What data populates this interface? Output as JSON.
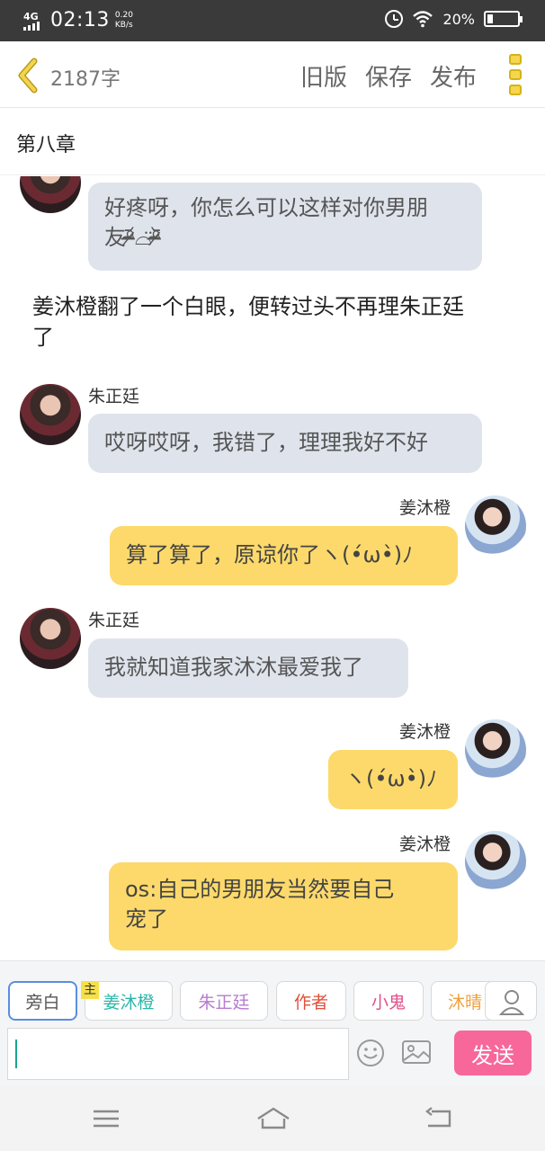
{
  "status_bar": {
    "network": "4G",
    "time": "02:13",
    "speed_value": "0.20",
    "speed_unit": "KB/s",
    "battery": "20%",
    "battery_level": 0.2
  },
  "top_bar": {
    "word_count": "2187字",
    "actions": [
      "旧版",
      "保存",
      "发布"
    ]
  },
  "chapter_title": "第八章",
  "chat": {
    "bubble1": "好疼呀，你怎么可以这样对你男朋友ᕙ( ︡'︡益'︠)ง",
    "bubble1_line1": "好疼呀，你怎么可以这样对你男朋",
    "bubble1_line2": "友ᵒ̴̶̷᷄⌓̈ᵒ̴̶̷᷅",
    "narration_line1": "姜沐橙翻了一个白眼，便转过头不再理朱正廷",
    "narration_line2": "了",
    "name_zhu": "朱正廷",
    "name_jiang": "姜沐橙",
    "bubble2": "哎呀哎呀，我错了，理理我好不好",
    "bubble3": "算了算了，原谅你了ヽ(•́ω•̀)ﾉ",
    "bubble4": "我就知道我家沐沐最爱我了",
    "bubble5": "ヽ(•́ω•̀)ﾉ",
    "bubble6_line1": "os:自己的男朋友当然要自己",
    "bubble6_line2": "宠了"
  },
  "roles": {
    "host_badge": "主",
    "items": [
      "旁白",
      "姜沐橙",
      "朱正廷",
      "作者",
      "小鬼",
      "沐晴"
    ],
    "colors": [
      "#555555",
      "#2bb7a8",
      "#b77bd0",
      "#e0503a",
      "#e0508a",
      "#f0a040"
    ]
  },
  "composer": {
    "send_label": "发送"
  },
  "colors": {
    "accent_yellow": "#fcd96a",
    "bubble_grey": "#dfe4ec",
    "send_pink": "#f7679a"
  }
}
